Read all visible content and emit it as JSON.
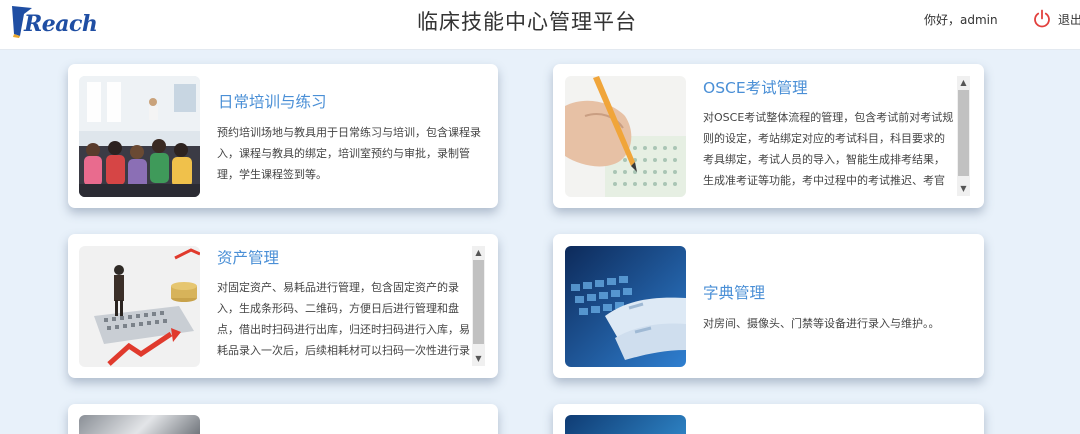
{
  "app": {
    "logo_text": "Reach",
    "title": "临床技能中心管理平台",
    "greeting": "你好，admin",
    "logout_label": "退出",
    "logout_icon": "power-icon"
  },
  "colors": {
    "accent": "#4a8fd6",
    "logo": "#1f4ea3",
    "logout": "#e2403d",
    "background": "#e8f1fa"
  },
  "modules": [
    {
      "title": "日常培训与练习",
      "description": "预约培训场地与教具用于日常练习与培训，包含课程录入，课程与教具的绑定，培训室预约与审批，录制管理，学生课程签到等。",
      "image": "classroom-photo"
    },
    {
      "title": "OSCE考试管理",
      "description": "对OSCE考试整体流程的管理，包含考试前对考试规则的设定，考站绑定对应的考试科目，科目要求的考具绑定，考试人员的导入，智能生成排考结果，生成准考证等功能，考中过程中的考试推迟、考官替换等，考后的成绩统计、发布。",
      "image": "exam-pencil-photo"
    },
    {
      "title": "资产管理",
      "description": "对固定资产、易耗品进行管理，包含固定资产的录入，生成条形码、二维码，方便日后进行管理和盘点，借出时扫码进行出库，归还时扫码进行入库，易耗品录入一次后，后续相耗材可以扫码一次性进行录入，减少人工录入的成本。",
      "image": "assets-photo"
    },
    {
      "title": "字典管理",
      "description": "对房间、摄像头、门禁等设备进行录入与维护。。",
      "image": "keyboard-photo"
    }
  ]
}
